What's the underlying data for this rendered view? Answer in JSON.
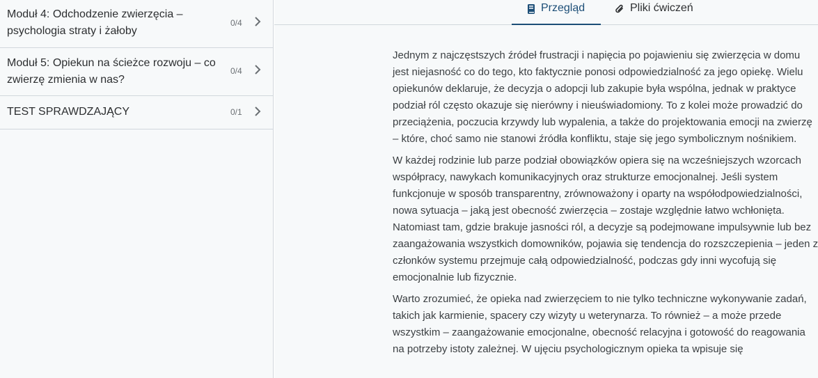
{
  "sidebar": {
    "modules": [
      {
        "title": "Moduł 4: Odchodzenie zwierzęcia – psychologia straty i żałoby",
        "progress": "0/4"
      },
      {
        "title": "Moduł 5: Opiekun na ścieżce rozwoju – co zwierzę zmienia w nas?",
        "progress": "0/4"
      },
      {
        "title": "TEST SPRAWDZAJĄCY",
        "progress": "0/1"
      }
    ]
  },
  "tabs": {
    "overview": {
      "label": "Przegląd",
      "icon": "book-icon",
      "active": true
    },
    "files": {
      "label": "Pliki ćwiczeń",
      "icon": "paperclip-icon"
    }
  },
  "content": {
    "paragraphs": [
      "Jednym z najczęstszych źródeł frustracji i napięcia po pojawieniu się zwierzęcia w domu jest niejasność co do tego, kto faktycznie ponosi odpowiedzialność za jego opiekę. Wielu opiekunów deklaruje, że decyzja o adopcji lub zakupie była wspólna, jednak w praktyce podział ról często okazuje się nierówny i nieuświadomiony. To z kolei może prowadzić do przeciążenia, poczucia krzywdy lub wypalenia, a także do projektowania emocji na zwierzę – które, choć samo nie stanowi źródła konfliktu, staje się jego symbolicznym nośnikiem.",
      "W każdej rodzinie lub parze podział obowiązków opiera się na wcześniejszych wzorcach współpracy, nawykach komunikacyjnych oraz strukturze emocjonalnej. Jeśli system funkcjonuje w sposób transparentny, zrównoważony i oparty na współodpowiedzialności, nowa sytuacja – jaką jest obecność zwierzęcia – zostaje względnie łatwo wchłonięta. Natomiast tam, gdzie brakuje jasności ról, a decyzje są podejmowane impulsywnie lub bez zaangażowania wszystkich domowników, pojawia się tendencja do rozszczepienia – jeden z członków systemu przejmuje całą odpowiedzialność, podczas gdy inni wycofują się emocjonalnie lub fizycznie.",
      "Warto zrozumieć, że opieka nad zwierzęciem to nie tylko techniczne wykonywanie zadań, takich jak karmienie, spacery czy wizyty u weterynarza. To również – a może przede wszystkim – zaangażowanie emocjonalne, obecność relacyjna i gotowość do reagowania na potrzeby istoty zależnej. W ujęciu psychologicznym opieka ta wpisuje się"
    ]
  }
}
